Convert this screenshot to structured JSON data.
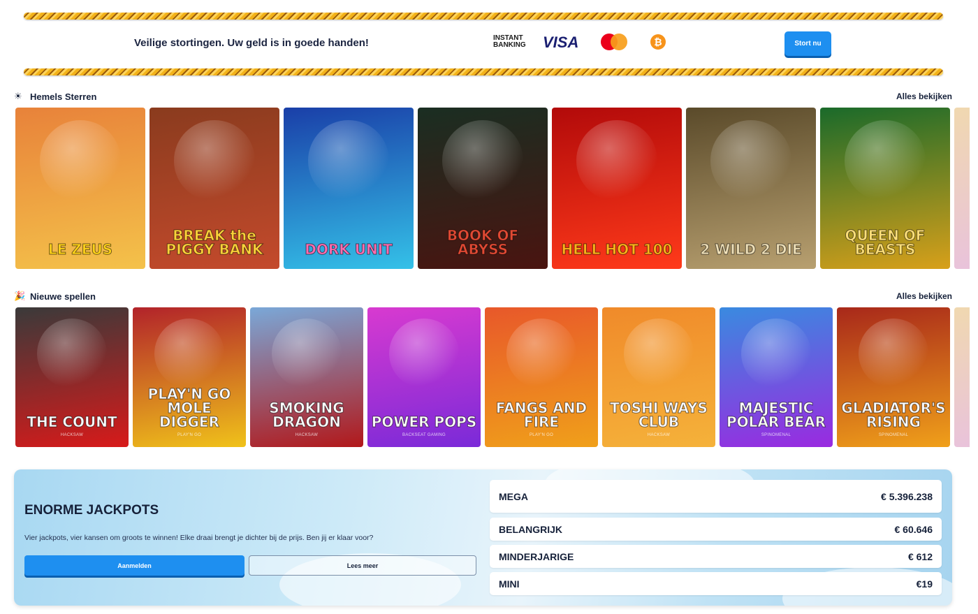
{
  "banner": {
    "text": "Veilige stortingen. Uw geld is in goede handen!",
    "payments": {
      "instant_line1": "INSTANT",
      "instant_line2": "BANKING",
      "visa": "VISA",
      "mastercard": "mastercard-icon",
      "bitcoin": "₿"
    },
    "deposit_button": "Stort nu"
  },
  "sections": {
    "featured": {
      "icon": "☀",
      "title": "Hemels Sterren",
      "more": "Alles bekijken",
      "games": [
        {
          "name": "LE ZEUS",
          "colors": [
            "#e8823a",
            "#f4c24a"
          ],
          "text_color": "#ffd21a"
        },
        {
          "name": "BREAK the PIGGY BANK",
          "colors": [
            "#8a3b1e",
            "#c44a2c"
          ],
          "text_color": "#ffd23a"
        },
        {
          "name": "DORK UNIT",
          "colors": [
            "#1a3fa8",
            "#34c1e8"
          ],
          "text_color": "#ff6fb2"
        },
        {
          "name": "BOOK OF ABYSS",
          "colors": [
            "#1a2e22",
            "#4a1410"
          ],
          "text_color": "#e24a34"
        },
        {
          "name": "HELL HOT 100",
          "colors": [
            "#b20a0a",
            "#ff3a1a"
          ],
          "text_color": "#ffb21a"
        },
        {
          "name": "2 WILD 2 DIE",
          "colors": [
            "#5a4a2a",
            "#b8a070"
          ],
          "text_color": "#efe0b8"
        },
        {
          "name": "QUEEN OF BEASTS",
          "colors": [
            "#1a6a2a",
            "#d8a01a"
          ],
          "text_color": "#ffe07a"
        }
      ]
    },
    "new": {
      "icon": "🎉",
      "title": "Nieuwe spellen",
      "more": "Alles bekijken",
      "games": [
        {
          "name": "THE COUNT",
          "provider": "HACKSAW",
          "colors": [
            "#3a3a3a",
            "#d81a1a"
          ],
          "text_color": "#ffffff"
        },
        {
          "name": "PLAY'N GO MOLE DIGGER",
          "provider": "PLAY'N GO",
          "colors": [
            "#b2232a",
            "#f0c21a"
          ],
          "text_color": "#ffffff"
        },
        {
          "name": "SMOKING DRAGON",
          "provider": "HACKSAW",
          "colors": [
            "#7aa8d8",
            "#b2181a"
          ],
          "text_color": "#ffffff"
        },
        {
          "name": "POWER POPS",
          "provider": "BACKSEAT GAMING",
          "colors": [
            "#d83ad0",
            "#7a2ad8"
          ],
          "text_color": "#ffffff"
        },
        {
          "name": "FANGS AND FIRE",
          "provider": "PLAY'N GO",
          "colors": [
            "#e8582a",
            "#f0a01a"
          ],
          "text_color": "#ffffff"
        },
        {
          "name": "TOSHI WAYS CLUB",
          "provider": "HACKSAW",
          "colors": [
            "#f08a2a",
            "#f5b23a"
          ],
          "text_color": "#ffffff"
        },
        {
          "name": "MAJESTIC POLAR BEAR",
          "provider": "SPINOMENAL",
          "colors": [
            "#3a8ae0",
            "#9a2ae0"
          ],
          "text_color": "#ffffff"
        },
        {
          "name": "GLADIATOR'S RISING",
          "provider": "SPINOMENAL",
          "colors": [
            "#a8281a",
            "#f0a01a"
          ],
          "text_color": "#ffffff"
        }
      ]
    }
  },
  "jackpots": {
    "title": "ENORME JACKPOTS",
    "description": "Vier jackpots, vier kansen om groots te winnen! Elke draai brengt je dichter bij de prijs. Ben jij er klaar voor?",
    "signup_button": "Aanmelden",
    "read_more_button": "Lees meer",
    "items": [
      {
        "label": "MEGA",
        "value": "€ 5.396.238"
      },
      {
        "label": "BELANGRIJK",
        "value": "€ 60.646"
      },
      {
        "label": "MINDERJARIGE",
        "value": "€ 612"
      },
      {
        "label": "MINI",
        "value": "€19"
      }
    ]
  }
}
